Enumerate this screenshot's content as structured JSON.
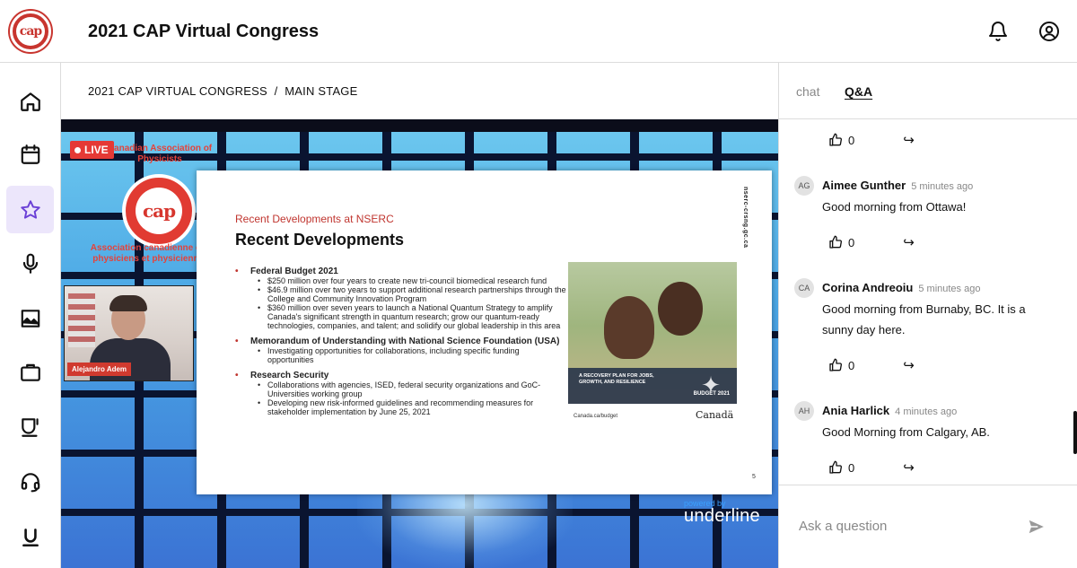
{
  "header": {
    "logo_text": "cap",
    "title": "2021 CAP Virtual Congress",
    "icons": [
      "bell-icon",
      "user-circle-icon"
    ]
  },
  "sidebar": {
    "items": [
      {
        "name": "home",
        "icon": "home-icon",
        "active": false
      },
      {
        "name": "calendar",
        "icon": "calendar-icon",
        "active": false
      },
      {
        "name": "favorites",
        "icon": "star-icon",
        "active": true
      },
      {
        "name": "microphone",
        "icon": "microphone-icon",
        "active": false
      },
      {
        "name": "gallery",
        "icon": "image-icon",
        "active": false
      },
      {
        "name": "exhibitors",
        "icon": "briefcase-icon",
        "active": false
      },
      {
        "name": "lounge",
        "icon": "coffee-cup-icon",
        "active": false
      },
      {
        "name": "support",
        "icon": "headset-icon",
        "active": false
      },
      {
        "name": "underline",
        "icon": "underline-logo-icon",
        "active": false
      }
    ]
  },
  "breadcrumb": {
    "event": "2021 CAP VIRTUAL CONGRESS",
    "separator": "/",
    "stage": "MAIN STAGE"
  },
  "video": {
    "live_label": "LIVE",
    "watermark_top": "Canadian Association of Physicists",
    "watermark_logo": "cap",
    "watermark_bottom": "Association canadienne des physiciens et physiciennes",
    "speaker_name": "Alejandro Adem",
    "powered_by": "powered by",
    "brand": "underline",
    "slide": {
      "subtitle": "Recent Developments at NSERC",
      "title": "Recent Developments",
      "side_url": "nserc-crsng.gc.ca",
      "sections": [
        {
          "heading": "Federal Budget 2021",
          "bullets": [
            "$250 million over four years to create new tri-council biomedical research fund",
            "$46.9 million over two years to support additional research partnerships through the College and Community Innovation Program",
            "$360 million over seven years to launch a National Quantum Strategy to amplify Canada's significant strength in quantum research; grow our quantum-ready technologies, companies, and talent; and solidify our global leadership in this area"
          ]
        },
        {
          "heading": "Memorandum of Understanding with National Science Foundation (USA)",
          "bullets": [
            "Investigating opportunities for collaborations, including specific funding opportunities"
          ]
        },
        {
          "heading": "Research Security",
          "bullets": [
            "Collaborations with agencies, ISED, federal security organizations and GoC-Universities working group",
            "Developing new risk-informed guidelines and recommending measures for stakeholder implementation by June 25, 2021"
          ]
        }
      ],
      "photo_caption": "A RECOVERY PLAN FOR JOBS, GROWTH, AND RESILIENCE",
      "photo_badge": "BUDGET 2021",
      "photo_url": "Canada.ca/budget",
      "wordmark": "Canadä",
      "page_number": "5"
    }
  },
  "panel": {
    "tabs": [
      {
        "label": "chat",
        "active": false
      },
      {
        "label": "Q&A",
        "active": true
      }
    ],
    "top_actions": {
      "likes": "0"
    },
    "questions": [
      {
        "initials": "AG",
        "author": "Aimee Gunther",
        "time": "5 minutes ago",
        "text": "Good morning from Ottawa!",
        "likes": "0"
      },
      {
        "initials": "CA",
        "author": "Corina Andreoiu",
        "time": "5 minutes ago",
        "text": "Good morning from Burnaby, BC. It is a sunny day here.",
        "likes": "0"
      },
      {
        "initials": "AH",
        "author": "Ania Harlick",
        "time": "4 minutes ago",
        "text": "Good Morning from Calgary, AB.",
        "likes": "0"
      }
    ],
    "ask": {
      "placeholder": "Ask a question",
      "value": ""
    }
  }
}
